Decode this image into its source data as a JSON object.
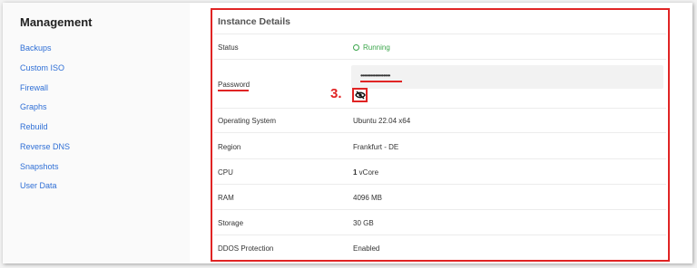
{
  "sidebar": {
    "title": "Management",
    "items": [
      {
        "label": "Backups"
      },
      {
        "label": "Custom ISO"
      },
      {
        "label": "Firewall"
      },
      {
        "label": "Graphs"
      },
      {
        "label": "Rebuild"
      },
      {
        "label": "Reverse DNS"
      },
      {
        "label": "Snapshots"
      },
      {
        "label": "User Data"
      }
    ]
  },
  "details": {
    "title": "Instance Details",
    "status": {
      "label": "Status",
      "value": "Running"
    },
    "password": {
      "label": "Password",
      "value": "••••••••••••••••••",
      "step": "3."
    },
    "os": {
      "label": "Operating System",
      "value": "Ubuntu 22.04 x64"
    },
    "region": {
      "label": "Region",
      "value": "Frankfurt - DE"
    },
    "cpu": {
      "label": "CPU",
      "value_num": "1",
      "value_unit": " vCore"
    },
    "ram": {
      "label": "RAM",
      "value": "4096 MB"
    },
    "storage": {
      "label": "Storage",
      "value": "30 GB"
    },
    "ddos": {
      "label": "DDOS Protection",
      "value": "Enabled"
    }
  },
  "colors": {
    "link": "#2f6fd6",
    "highlight": "#e02424",
    "status_ok": "#3aa54a"
  },
  "icons": {
    "status": "running-ring-icon",
    "reveal": "eye-slash-icon"
  }
}
